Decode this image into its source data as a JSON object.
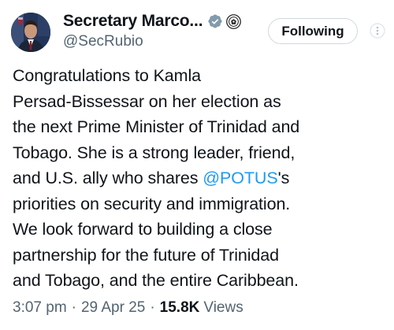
{
  "author": {
    "display_name": "Secretary Marco...",
    "handle": "@SecRubio",
    "verified_icon": "verified-badge-icon",
    "affiliation_icon": "state-department-seal-icon"
  },
  "follow_button": {
    "label": "Following"
  },
  "more_icon": "more-options-icon",
  "tweet": {
    "lines": [
      {
        "before": "Congratulations to Kamla",
        "mention": "",
        "after": ""
      },
      {
        "before": "Persad-Bissessar on her election as",
        "mention": "",
        "after": ""
      },
      {
        "before": "the next Prime Minister of Trinidad and",
        "mention": "",
        "after": ""
      },
      {
        "before": "Tobago. She is a strong leader, friend,",
        "mention": "",
        "after": ""
      },
      {
        "before": "and U.S. ally who shares ",
        "mention": "@POTUS",
        "after": "'s"
      },
      {
        "before": "priorities on security and immigration.",
        "mention": "",
        "after": ""
      },
      {
        "before": "We look forward to building a close",
        "mention": "",
        "after": ""
      },
      {
        "before": "partnership for the future of Trinidad",
        "mention": "",
        "after": ""
      },
      {
        "before": "and Tobago, and the entire Caribbean.",
        "mention": "",
        "after": ""
      }
    ]
  },
  "meta": {
    "time": "3:07 pm",
    "separator": "·",
    "date": "29 Apr 25",
    "views_count": "15.8K",
    "views_label": "Views"
  },
  "colors": {
    "text": "#0f1419",
    "secondary": "#536471",
    "link": "#1d9bf0",
    "verified": "#829aab",
    "border": "#cfd9de"
  }
}
